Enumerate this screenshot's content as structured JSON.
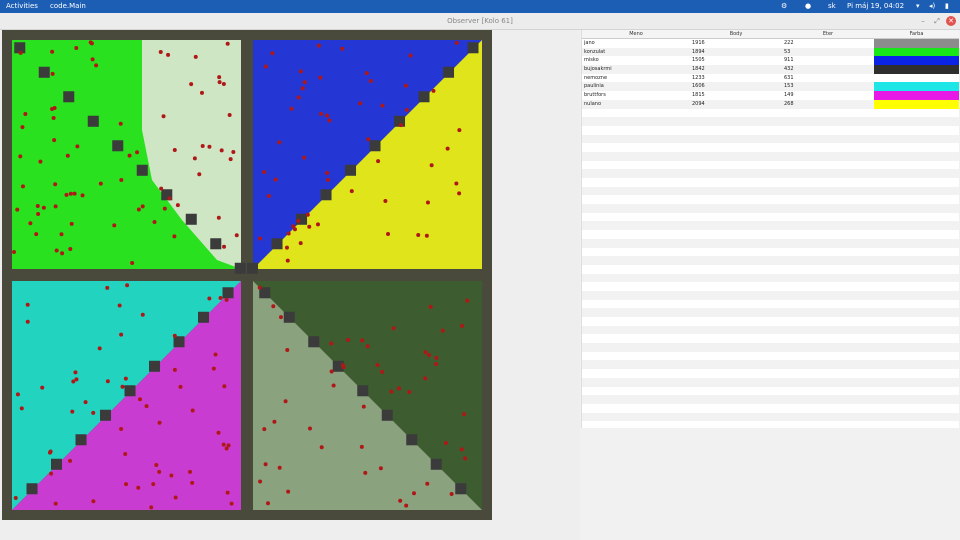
{
  "topbar": {
    "activities": "Activities",
    "app_name": "code.Main",
    "lang": "sk",
    "clock": "Pi máj 19, 04:02",
    "icons": [
      "gear-icon",
      "chat-icon",
      "wifi-icon",
      "volume-icon",
      "battery-icon"
    ]
  },
  "window": {
    "title": "Observer [Kolo 61]",
    "buttons": [
      "minimize-icon",
      "maximize-icon",
      "close-icon"
    ]
  },
  "table": {
    "headers": [
      "Meno",
      "Body",
      "Eter",
      "Farba"
    ],
    "rows": [
      {
        "name": "jano",
        "body": "1916",
        "eter": "222",
        "color": "#8c8c8c"
      },
      {
        "name": "konzulat",
        "body": "1894",
        "eter": "53",
        "color": "#19e619"
      },
      {
        "name": "misko",
        "body": "1505",
        "eter": "911",
        "color": "#0a23e6"
      },
      {
        "name": "bujosakrmi",
        "body": "1842",
        "eter": "432",
        "color": "#2e2e2e"
      },
      {
        "name": "nemozne",
        "body": "1233",
        "eter": "631",
        "color": "#ffffff"
      },
      {
        "name": "paulinia",
        "body": "1606",
        "eter": "153",
        "color": "#1ee6e6"
      },
      {
        "name": "bruttfors",
        "body": "1815",
        "eter": "149",
        "color": "#e619e6"
      },
      {
        "name": "nulano",
        "body": "2094",
        "eter": "268",
        "color": "#ffff00"
      }
    ]
  },
  "board": {
    "grid": 40,
    "colors": {
      "border": "#4a4a3c",
      "green": "#29e11e",
      "light": "#cfe6c4",
      "blue": "#2436d4",
      "yellow": "#dfe51a",
      "cyan": "#22d4c0",
      "magenta": "#c83cd1",
      "dark": "#3d5c2f",
      "sage": "#8aa27e",
      "wall": "#3b3b3b",
      "dot": "#b01818"
    }
  }
}
